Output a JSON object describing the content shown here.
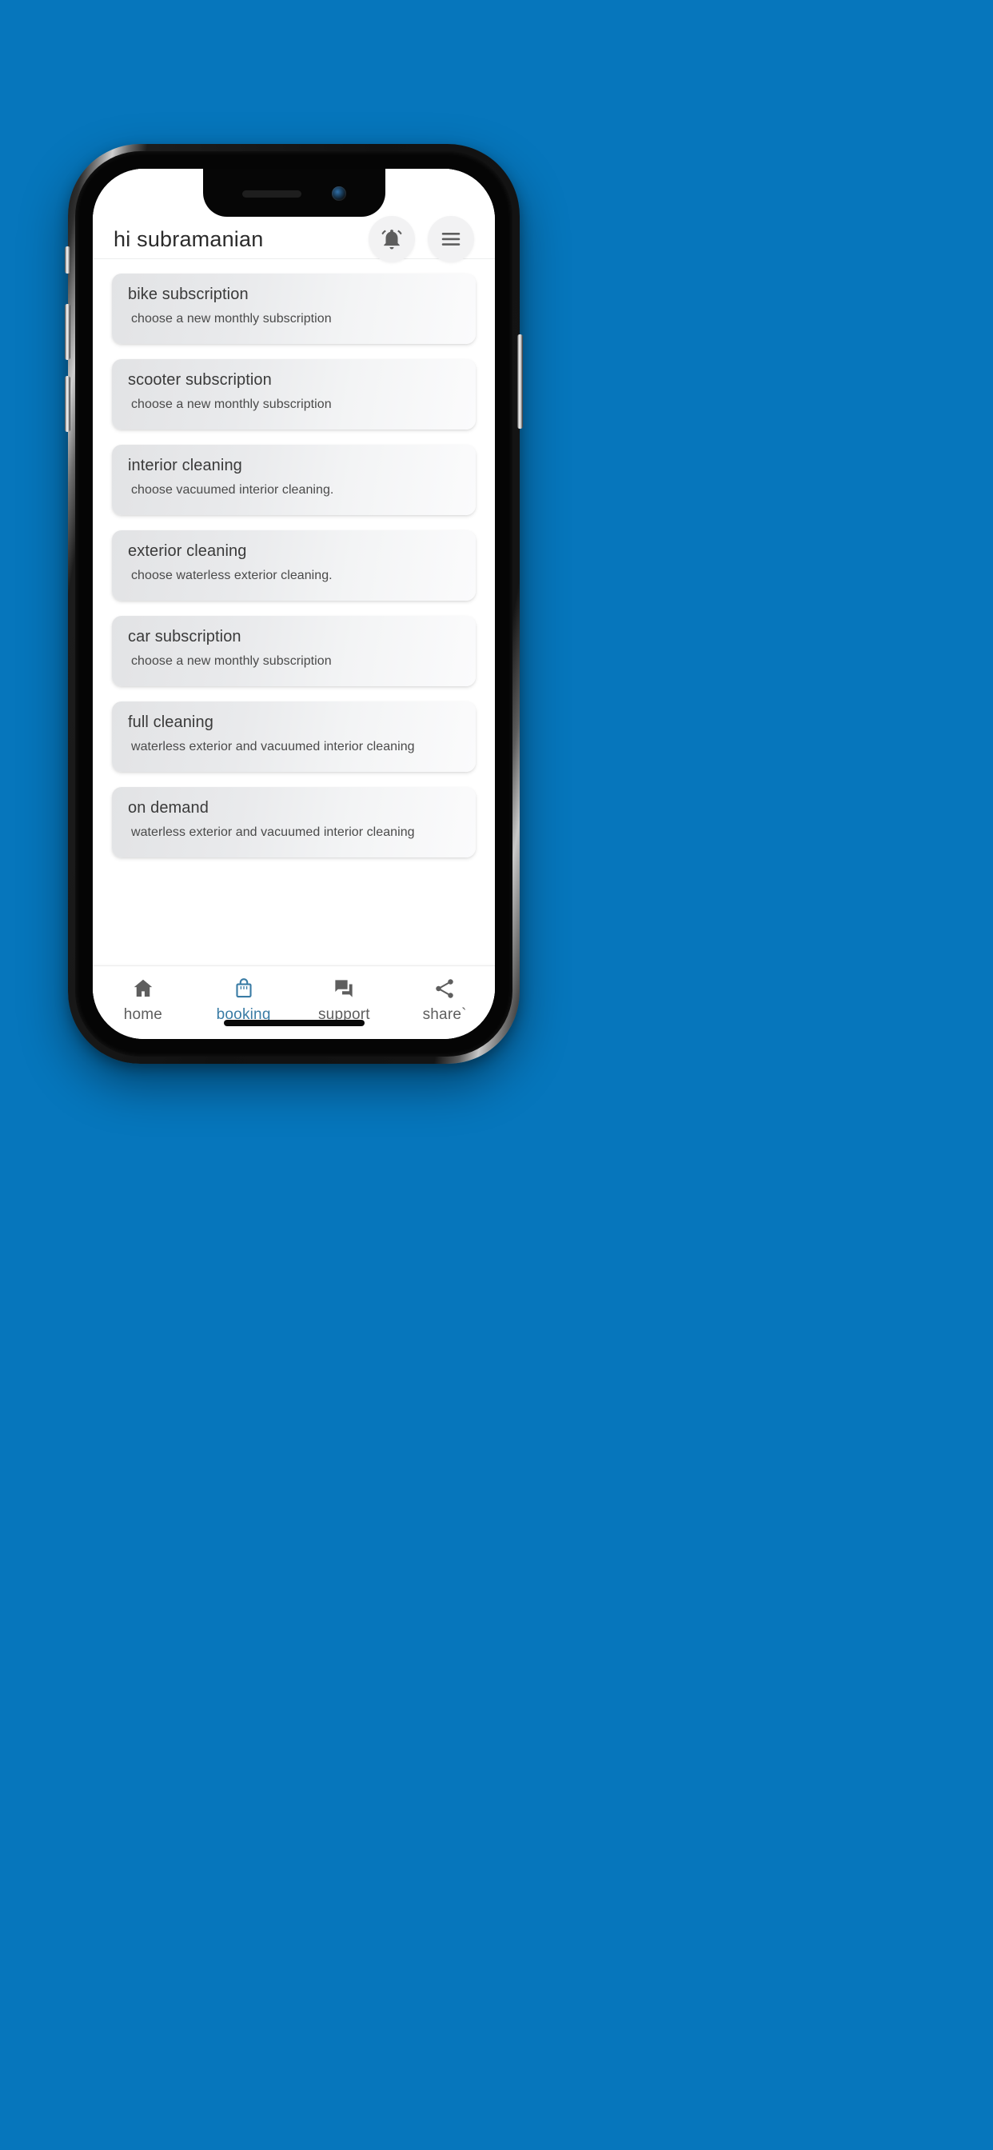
{
  "theme": {
    "page_background": "#0676bc",
    "screen_background": "#ffffff",
    "accent": "#3a7ca5",
    "icon_gray": "#5e5e5e",
    "card_gradient_start": "#e2e3e5",
    "card_gradient_end": "#fbfbfc"
  },
  "header": {
    "greeting": "hi subramanian",
    "notification_icon": "bell-active-icon",
    "menu_icon": "hamburger-menu-icon"
  },
  "cards": [
    {
      "title": "bike subscription",
      "subtitle": "choose a new monthly subscription"
    },
    {
      "title": "scooter subscription",
      "subtitle": "choose a new monthly subscription"
    },
    {
      "title": "interior cleaning",
      "subtitle": "choose vacuumed interior cleaning."
    },
    {
      "title": "exterior cleaning",
      "subtitle": "choose waterless exterior cleaning."
    },
    {
      "title": "car subscription",
      "subtitle": "choose a new monthly subscription"
    },
    {
      "title": "full cleaning",
      "subtitle": "waterless exterior and vacuumed interior cleaning"
    },
    {
      "title": "on demand",
      "subtitle": "waterless exterior and vacuumed interior cleaning"
    }
  ],
  "bottom_nav": {
    "items": [
      {
        "label": "home",
        "icon": "home-icon",
        "active": false
      },
      {
        "label": "booking",
        "icon": "shopping-bag-icon",
        "active": true
      },
      {
        "label": "support",
        "icon": "chat-bubble-icon",
        "active": false
      },
      {
        "label": "share`",
        "icon": "share-icon",
        "active": false
      }
    ]
  }
}
